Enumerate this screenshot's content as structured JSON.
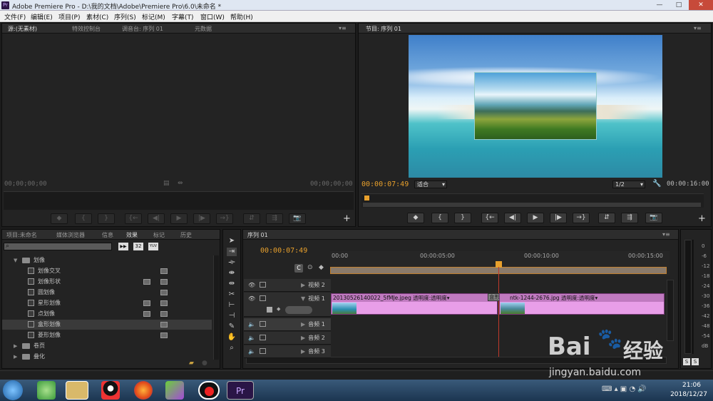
{
  "window": {
    "title": "Adobe Premiere Pro - D:\\我的文档\\Adobe\\Premiere Pro\\6.0\\未命名 *",
    "app_icon": "Pr",
    "controls": {
      "minimize": "—",
      "maximize": "□",
      "close": "✕"
    }
  },
  "menu": [
    "文件(F)",
    "编辑(E)",
    "项目(P)",
    "素材(C)",
    "序列(S)",
    "标记(M)",
    "字幕(T)",
    "窗口(W)",
    "帮助(H)"
  ],
  "source_panel": {
    "tabs": [
      "源:(无素材)",
      "特效控制台",
      "调音台: 序列 01",
      "元数据"
    ],
    "timecode_left": "00;00;00;00",
    "timecode_right": "00;00;00;00"
  },
  "program_panel": {
    "tab": "节目: 序列 01",
    "timecode": "00:00:07:49",
    "fit": "适合",
    "resolution": "1/2",
    "duration": "00:00:16:00"
  },
  "transport": {
    "marker": "◆",
    "in": "{",
    "out": "}",
    "go_in": "{←",
    "step_back": "◀|",
    "play": "▶",
    "step_fwd": "|▶",
    "go_out": "→}",
    "lift": "⇵",
    "extract": "⇶",
    "export": "📷",
    "add": "+"
  },
  "project_panel": {
    "tabs": [
      "项目:未命名",
      "媒体浏览器",
      "信息",
      "效果",
      "标记",
      "历史"
    ],
    "search_placeholder": "",
    "buttons": [
      "▶▶",
      "32",
      "YUV"
    ],
    "items": [
      {
        "label": "划像",
        "type": "folder",
        "open": true
      },
      {
        "label": "划像交叉",
        "type": "effect"
      },
      {
        "label": "划像形状",
        "type": "effect"
      },
      {
        "label": "圆划像",
        "type": "effect"
      },
      {
        "label": "星形划像",
        "type": "effect"
      },
      {
        "label": "点划像",
        "type": "effect"
      },
      {
        "label": "盒形划像",
        "type": "effect",
        "selected": true
      },
      {
        "label": "菱形划像",
        "type": "effect"
      },
      {
        "label": "卷页",
        "type": "folder",
        "open": false
      },
      {
        "label": "叠化",
        "type": "folder",
        "open": false
      }
    ]
  },
  "timeline": {
    "tab": "序列 01",
    "timecode": "00:00:07:49",
    "ruler": [
      "00:00",
      "00:00:05:00",
      "00:00:10:00",
      "00:00:15:00"
    ],
    "tracks": [
      {
        "name": "视频 2",
        "kind": "video"
      },
      {
        "name": "视频 1",
        "kind": "video"
      },
      {
        "name": "音频 1",
        "kind": "audio"
      },
      {
        "name": "音频 2",
        "kind": "audio"
      },
      {
        "name": "音频 3",
        "kind": "audio"
      }
    ],
    "clips": {
      "clip1": "20130526140022_5fMJe.jpeg",
      "clip1_fx": "透明度:透明度",
      "transition": "盒形划",
      "clip2": "ntk-1244-2676.jpg",
      "clip2_fx": "透明度:透明度"
    }
  },
  "audio_meter": {
    "scale": [
      "0",
      "-6",
      "-12",
      "-18",
      "-24",
      "-30",
      "-36",
      "-42",
      "-48",
      "-54",
      "dB"
    ],
    "solo": [
      "S",
      "S"
    ]
  },
  "watermark": {
    "brand": "Bai",
    "brand2": "经验",
    "url": "jingyan.baidu.com"
  },
  "taskbar": {
    "time": "21:06",
    "date": "2018/12/27",
    "pr_label": "Pr"
  }
}
